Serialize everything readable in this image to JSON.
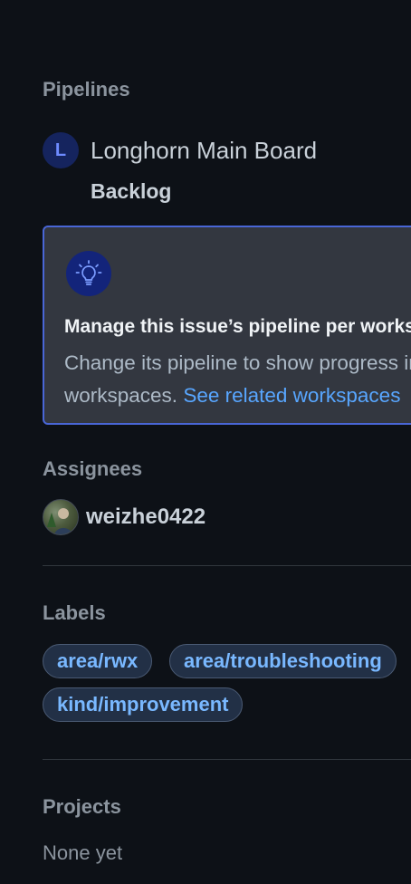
{
  "pipelines": {
    "title": "Pipelines",
    "board": {
      "avatar_letter": "L",
      "name": "Longhorn Main Board",
      "stage": "Backlog"
    },
    "callout": {
      "icon": "lightbulb-icon",
      "heading": "Manage this issue’s pipeline per workspace",
      "body_line1": "Change its pipeline to show progress in",
      "body_line2_prefix": "workspaces. ",
      "link": "See related workspaces"
    }
  },
  "assignees": {
    "title": "Assignees",
    "users": [
      {
        "name": "weizhe0422"
      }
    ]
  },
  "labels": {
    "title": "Labels",
    "items": [
      "area/rwx",
      "area/troubleshooting",
      "kind/improvement"
    ]
  },
  "projects": {
    "title": "Projects",
    "value": "None yet"
  },
  "colors": {
    "background": "#0d1117",
    "callout_border": "#4966d6",
    "link": "#58a6ff",
    "label_text": "#79b8ff"
  }
}
